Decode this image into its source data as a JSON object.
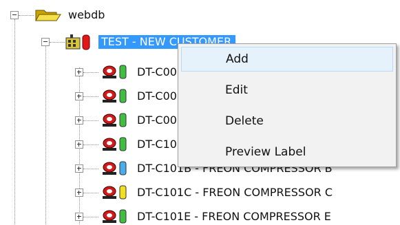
{
  "root": {
    "label": "webdb",
    "icon": "folder-open-icon"
  },
  "customer": {
    "label": "TEST - NEW CUSTOMER",
    "icon": "building-alert-icon",
    "selected": true
  },
  "items": [
    {
      "label": "DT-C001A - FREON COMPRESSOR A",
      "indicator_color": "#3fbf3f"
    },
    {
      "label": "DT-C001B - FREON COMPRESSOR B",
      "indicator_color": "#3fbf3f"
    },
    {
      "label": "DT-C001C - FREON COMPRESSOR C",
      "indicator_color": "#3fbf3f"
    },
    {
      "label": "DT-C101A - FREON COMPRESSOR A",
      "indicator_color": "#3fbf3f"
    },
    {
      "label": "DT-C101B - FREON COMPRESSOR B",
      "indicator_color": "#4aaeea"
    },
    {
      "label": "DT-C101C - FREON COMPRESSOR C",
      "indicator_color": "#f0e020"
    },
    {
      "label": "DT-C101E - FREON COMPRESSOR E",
      "indicator_color": "#3fbf3f"
    }
  ],
  "context_menu": {
    "items": [
      {
        "label": "Add",
        "highlighted": true
      },
      {
        "label": "Edit",
        "highlighted": false
      },
      {
        "label": "Delete",
        "highlighted": false
      },
      {
        "label": "Preview Label",
        "highlighted": false
      }
    ]
  },
  "colors": {
    "selection": "#3399ff",
    "menu_background": "#f2f2f2",
    "menu_hover": "#e5f1fb"
  }
}
